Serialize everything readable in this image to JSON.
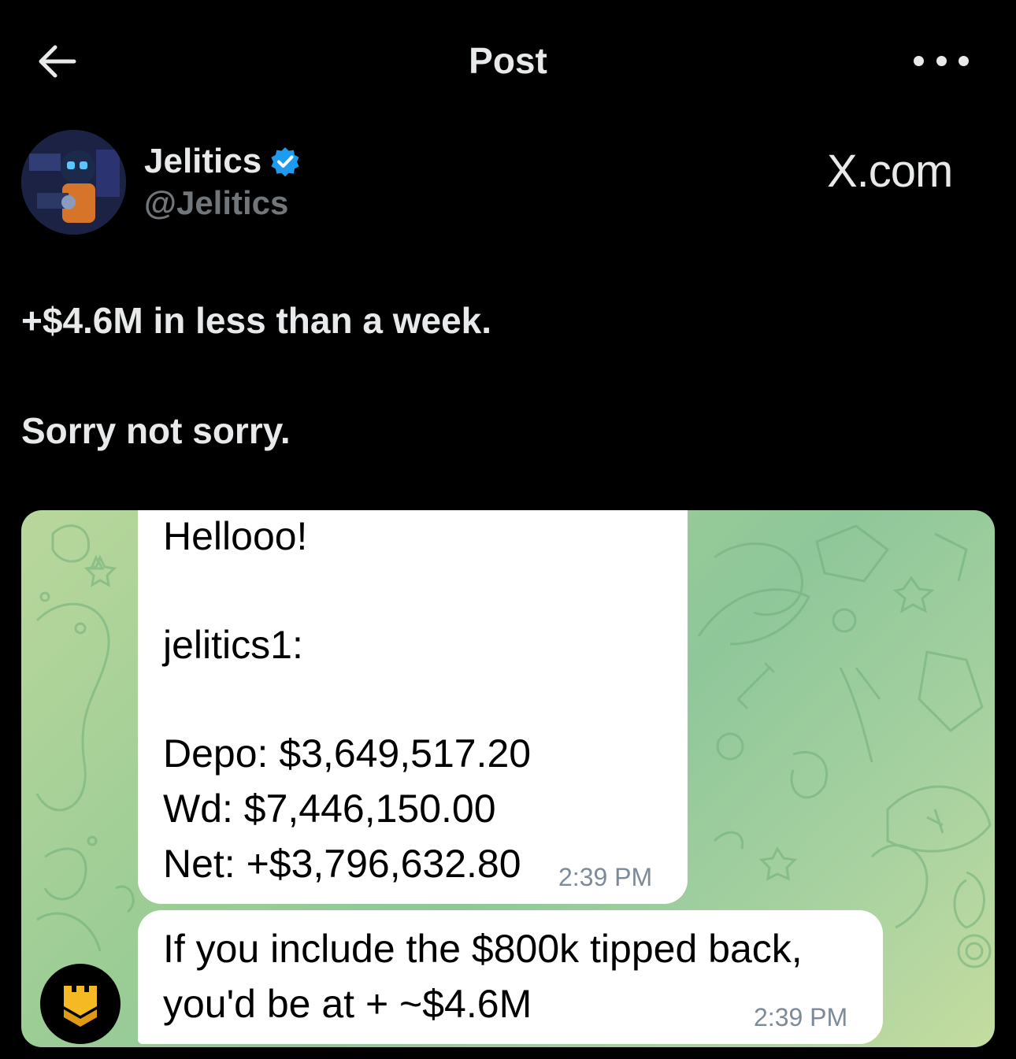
{
  "header": {
    "title": "Post"
  },
  "author": {
    "name": "Jelitics",
    "handle": "@Jelitics"
  },
  "source_label": "X.com",
  "post": {
    "line1": "+$4.6M in less than a week.",
    "line2": "Sorry not sorry."
  },
  "chat": {
    "message1": {
      "lines": [
        "Hellooo!",
        "jelitics1:",
        "Depo: $3,649,517.20",
        "Wd: $7,446,150.00",
        "Net: +$3,796,632.80"
      ],
      "time": "2:39 PM"
    },
    "message2": {
      "lines": [
        "If you include the $800k tipped back,",
        "you'd be at + ~$4.6M"
      ],
      "time": "2:39 PM"
    }
  },
  "icons": {
    "back": "arrow-left-icon",
    "more": "more-horizontal-icon",
    "verified": "verified-badge-icon"
  },
  "colors": {
    "verified": "#1d9bf0",
    "background": "#000000",
    "chat_bg": "#9ccd95"
  }
}
